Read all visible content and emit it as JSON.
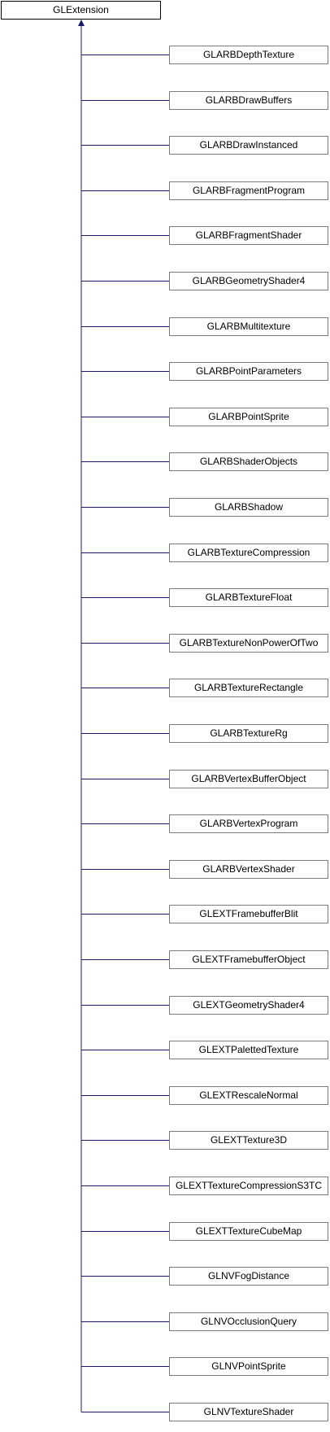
{
  "diagram": {
    "type": "inheritance",
    "base_class": "GLExtension",
    "derived_classes": [
      "GLARBDepthTexture",
      "GLARBDrawBuffers",
      "GLARBDrawInstanced",
      "GLARBFragmentProgram",
      "GLARBFragmentShader",
      "GLARBGeometryShader4",
      "GLARBMultitexture",
      "GLARBPointParameters",
      "GLARBPointSprite",
      "GLARBShaderObjects",
      "GLARBShadow",
      "GLARBTextureCompression",
      "GLARBTextureFloat",
      "GLARBTextureNonPowerOfTwo",
      "GLARBTextureRectangle",
      "GLARBTextureRg",
      "GLARBVertexBufferObject",
      "GLARBVertexProgram",
      "GLARBVertexShader",
      "GLEXTFramebufferBlit",
      "GLEXTFramebufferObject",
      "GLEXTGeometryShader4",
      "GLEXTPalettedTexture",
      "GLEXTRescaleNormal",
      "GLEXTTexture3D",
      "GLEXTTextureCompressionS3TC",
      "GLEXTTextureCubeMap",
      "GLNVFogDistance",
      "GLNVOcclusionQuery",
      "GLNVPointSprite",
      "GLNVTextureShader"
    ],
    "colors": {
      "connector": "#191970",
      "node_border": "#7a7a7a",
      "base_border": "#000000",
      "background": "#ffffff"
    }
  }
}
